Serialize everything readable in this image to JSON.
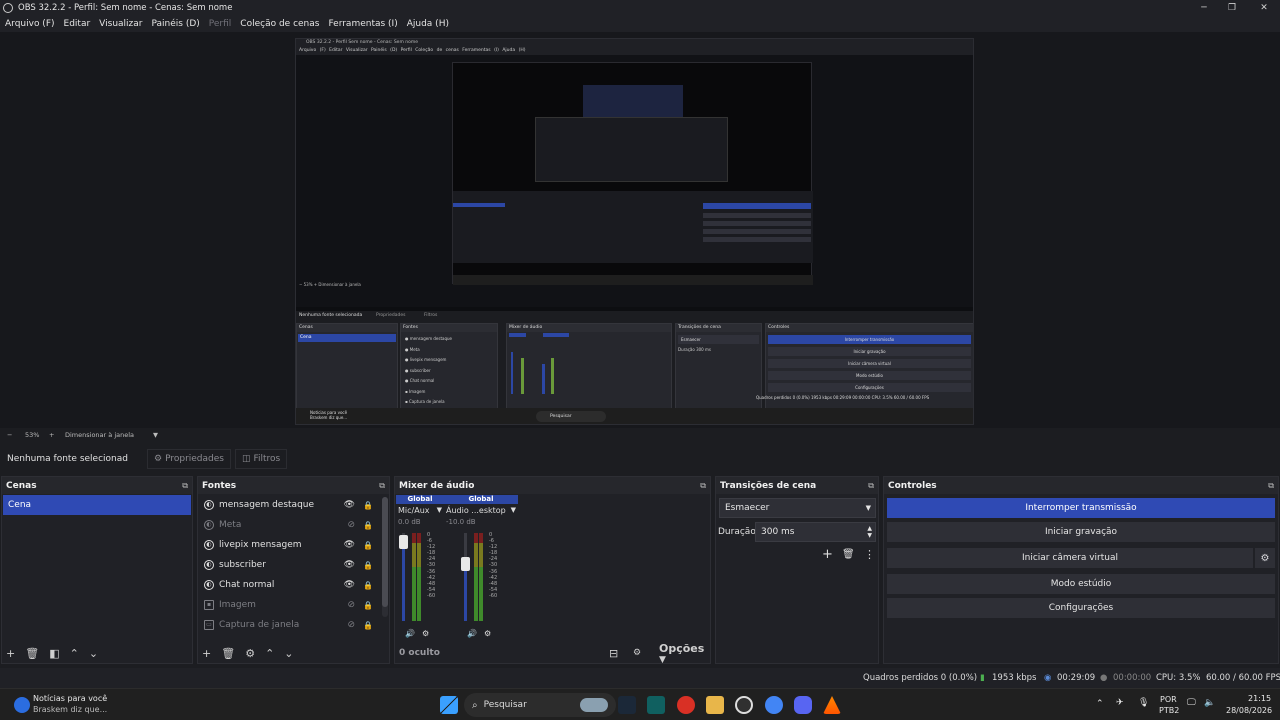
{
  "window": {
    "title": "OBS 32.2.2 - Perfil: Sem nome - Cenas: Sem nome",
    "min": "─",
    "max": "❐",
    "close": "✕"
  },
  "menu": [
    "Arquivo (F)",
    "Editar",
    "Visualizar",
    "Painéis (D)",
    "Perfil",
    "Coleção de cenas",
    "Ferramentas (I)",
    "Ajuda (H)"
  ],
  "nested": {
    "title": "OBS 32.2.2 - Perfil Sem nome - Cenas: Sem nome",
    "menu": "Arquivo (F)  Editar  Visualizar  Painéis (D)  Perfil  Coleção de cenas  Ferramentas (I)  Ajuda (H)",
    "no_source": "Nenhuma fonte selecionada",
    "props": "Propriedades",
    "filters": "Filtros",
    "scenes": "Cenas",
    "sources": "Fontes",
    "mixer": "Mixer de áudio",
    "transitions": "Transições de cena",
    "controls": "Controles",
    "stop": "Interromper transmissão",
    "record": "Iniciar gravação",
    "vcam": "Iniciar câmera virtual",
    "studio": "Modo estúdio",
    "settings": "Configurações",
    "scene": "Cena",
    "fade": "Esmaecer",
    "duration": "Duração",
    "ms": "300 ms",
    "stats": "Quadros perdidos 0 (0.0%)  1953 kbps  00:29:09  00:00:00  CPU: 3.5%  60.00 / 60.00 FPS",
    "search": "Pesquisar",
    "news": "Notícias para você",
    "news_sub": "Braskem diz que..."
  },
  "zoom": {
    "minus": "−",
    "value": "53%",
    "plus": "+",
    "mode": "Dimensionar à janela",
    "arrow": "▼"
  },
  "source_bar": {
    "no_source": "Nenhuma fonte selecionad",
    "properties": "Propriedades",
    "filters": "Filtros"
  },
  "docks": {
    "scenes": {
      "title": "Cenas",
      "items": [
        "Cena"
      ]
    },
    "sources": {
      "title": "Fontes",
      "items": [
        {
          "name": "mensagem destaque",
          "visible": true
        },
        {
          "name": "Meta",
          "visible": false
        },
        {
          "name": "livepix mensagem",
          "visible": true
        },
        {
          "name": "subscriber",
          "visible": true
        },
        {
          "name": "Chat normal",
          "visible": true
        },
        {
          "name": "Imagem",
          "visible": false
        },
        {
          "name": "Captura de janela",
          "visible": false
        }
      ]
    },
    "mixer": {
      "title": "Mixer de áudio",
      "channels": [
        {
          "global": "Global",
          "name": "Mic/Aux",
          "db": "0.0 dB",
          "level": 0.9
        },
        {
          "global": "Global",
          "name": "Áudio ...esktop",
          "db": "-10.0 dB",
          "level": 0.65
        }
      ],
      "scale": [
        "0",
        "-6",
        "-12",
        "-18",
        "-24",
        "-30",
        "-36",
        "-42",
        "-48",
        "-54",
        "-60"
      ],
      "hidden": "0 oculto",
      "options": "Opções"
    },
    "transitions": {
      "title": "Transições de cena",
      "type": "Esmaecer",
      "duration_label": "Duração",
      "duration_value": "300 ms"
    },
    "controls": {
      "title": "Controles",
      "stop_stream": "Interromper transmissão",
      "start_record": "Iniciar gravação",
      "start_vcam": "Iniciar câmera virtual",
      "studio_mode": "Modo estúdio",
      "settings": "Configurações"
    }
  },
  "status": {
    "dropped": "Quadros perdidos 0 (0.0%)",
    "bitrate": "1953 kbps",
    "stream_time": "00:29:09",
    "rec_time": "00:00:00",
    "cpu": "CPU: 3.5%",
    "fps": "60.00 / 60.00 FPS"
  },
  "taskbar": {
    "news_title": "Notícias para você",
    "news_sub": "Braskem diz que...",
    "search": "Pesquisar",
    "lang1": "POR",
    "lang2": "PTB2",
    "time": "21:15",
    "date": "28/08/2026"
  },
  "colors": {
    "accent": "#2f4ab4",
    "bg": "#1c1d21",
    "panel": "#202126"
  }
}
